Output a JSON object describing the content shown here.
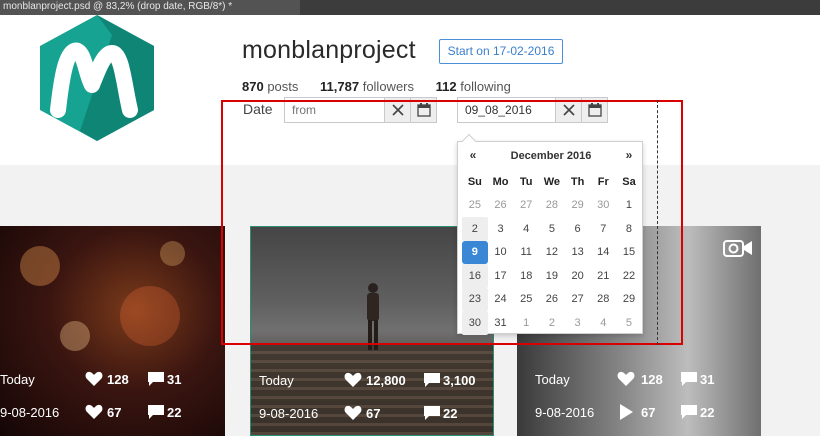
{
  "window": {
    "tab_title": "monblanproject.psd @ 83,2% (drop date, RGB/8*) *"
  },
  "profile": {
    "username": "monblanproject",
    "start_button": "Start on 17-02-2016",
    "stats": [
      {
        "count": "870",
        "label": "posts"
      },
      {
        "count": "11,787",
        "label": "followers"
      },
      {
        "count": "112",
        "label": "following"
      }
    ],
    "brand_color": "#17a392"
  },
  "filter": {
    "date_label": "Date",
    "from_placeholder": "from",
    "to_value": "09_08_2016",
    "clear_icon": "close-icon",
    "calendar_icon": "calendar-icon"
  },
  "calendar": {
    "prev": "«",
    "next": "»",
    "title": "December 2016",
    "weekdays": [
      "Su",
      "Mo",
      "Tu",
      "We",
      "Th",
      "Fr",
      "Sa"
    ],
    "weeks": [
      [
        "25",
        "26",
        "27",
        "28",
        "29",
        "30",
        "1"
      ],
      [
        "2",
        "3",
        "4",
        "5",
        "6",
        "7",
        "8"
      ],
      [
        "9",
        "10",
        "11",
        "12",
        "13",
        "14",
        "15"
      ],
      [
        "16",
        "17",
        "18",
        "19",
        "20",
        "21",
        "22"
      ],
      [
        "23",
        "24",
        "25",
        "26",
        "27",
        "28",
        "29"
      ],
      [
        "30",
        "31",
        "1",
        "2",
        "3",
        "4",
        "5"
      ]
    ],
    "selected": "9",
    "accent_color": "#3a87d6"
  },
  "cards": [
    {
      "today_label": "Today",
      "today_likes": "128",
      "today_comments": "31",
      "date_label": "9-08-2016",
      "date_likes": "67",
      "date_comments": "22"
    },
    {
      "today_label": "Today",
      "today_likes": "12,800",
      "today_comments": "3,100",
      "date_label": "9-08-2016",
      "date_likes": "67",
      "date_comments": "22"
    },
    {
      "today_label": "Today",
      "today_likes": "128",
      "today_comments": "31",
      "date_label": "9-08-2016",
      "date_likes": "67",
      "date_comments": "22"
    }
  ]
}
